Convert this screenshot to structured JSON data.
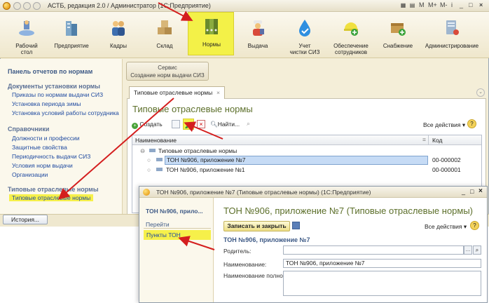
{
  "app": {
    "title": "АСТБ, редакция 2.0 / Администратор  (1С:Предприятие)",
    "window_buttons": [
      "M",
      "M+",
      "M-",
      "i",
      "_",
      "□",
      "×"
    ]
  },
  "sections": [
    {
      "label": "Рабочий\nстол",
      "icon": "desktop-icon"
    },
    {
      "label": "Предприятие",
      "icon": "building-icon"
    },
    {
      "label": "Кадры",
      "icon": "people-icon"
    },
    {
      "label": "Склад",
      "icon": "boxes-icon"
    },
    {
      "label": "Нормы",
      "icon": "binders-icon"
    },
    {
      "label": "Выдача",
      "icon": "worker-icon"
    },
    {
      "label": "Учет\nчистки СИЗ",
      "icon": "drop-icon"
    },
    {
      "label": "Обеспечение\nсотрудников",
      "icon": "helmet-icon"
    },
    {
      "label": "Снабжение",
      "icon": "package-icon"
    },
    {
      "label": "Администрирование",
      "icon": "server-icon"
    }
  ],
  "left_panel": {
    "title": "Панель отчетов по нормам",
    "group1": "Документы установки нормы",
    "group1_items": [
      "Приказы по нормам выдачи СИЗ",
      "Установка периода зимы",
      "Установка условий работы сотрудника"
    ],
    "group2": "Справочники",
    "group2_items": [
      "Должности и профессии",
      "Защитные свойства",
      "Периодичность выдачи СИЗ",
      "Условия норм выдачи",
      "Организации"
    ],
    "group3": "Типовые отраслевые нормы",
    "group3_item": "Типовые отраслевые нормы"
  },
  "history_button": "История...",
  "service_tab": {
    "line1": "Сервис",
    "line2": "Создание норм выдачи СИЗ"
  },
  "doc_tab": "Типовые отраслевые нормы",
  "form": {
    "title": "Типовые отраслевые нормы",
    "create": "Создать",
    "find": "Найти...",
    "all_actions": "Все действия",
    "help": "?",
    "col_name": "Наименование",
    "col_code": "Код",
    "group_row": "Типовые отраслевые нормы",
    "rows": [
      {
        "name": "ТОН №906, приложение №7",
        "code": "00-000002"
      },
      {
        "name": "ТОН №906, приложение №1",
        "code": "00-000001"
      }
    ]
  },
  "dialog": {
    "window_title": "ТОН №906, приложение №7 (Типовые отраслевые нормы)  (1С:Предприятие)",
    "left_title": "ТОН №906, прило...",
    "goto": "Перейти",
    "goto_item": "Пункты ТОН",
    "title": "ТОН №906, приложение №7 (Типовые отраслевые нормы)",
    "save_close": "Записать и закрыть",
    "all_actions": "Все действия",
    "help": "?",
    "subtitle": "ТОН №906, приложение №7",
    "parent_label": "Родитель:",
    "parent_value": "",
    "name_label": "Наименование:",
    "name_value": "ТОН №906, приложение №7",
    "fullname_label": "Наименование полное:",
    "fullname_value": ""
  },
  "colors": {
    "accent_yellow": "#f3f148",
    "link_blue": "#1f4aa0",
    "title_green": "#5c6f2a",
    "arrow_red": "#d41e1e"
  }
}
